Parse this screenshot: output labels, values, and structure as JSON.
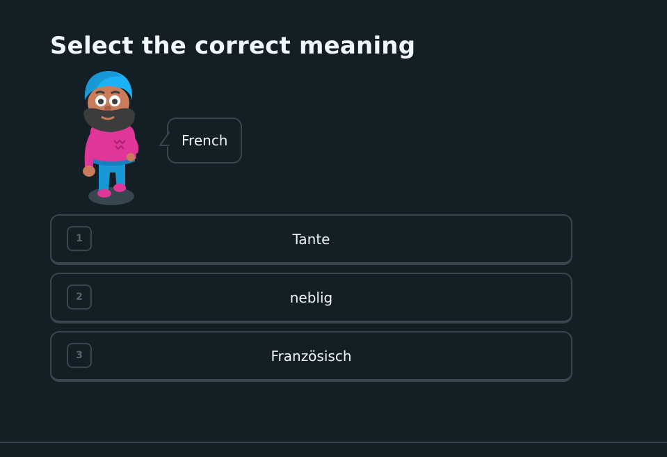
{
  "prompt": {
    "title": "Select the correct meaning",
    "speech_bubble": "French"
  },
  "choices": [
    {
      "key": "1",
      "label": "Tante"
    },
    {
      "key": "2",
      "label": "neblig"
    },
    {
      "key": "3",
      "label": "Französisch"
    }
  ],
  "colors": {
    "background": "#131f24",
    "border": "#37464f",
    "text": "#f1f7fb",
    "key_text": "#52656d",
    "turban": "#1cb0f6",
    "sweater": "#e0369a",
    "pants": "#1899d6",
    "beard": "#3c3c3c"
  },
  "icons": {
    "character": "bearded-turban-character-illustration"
  }
}
